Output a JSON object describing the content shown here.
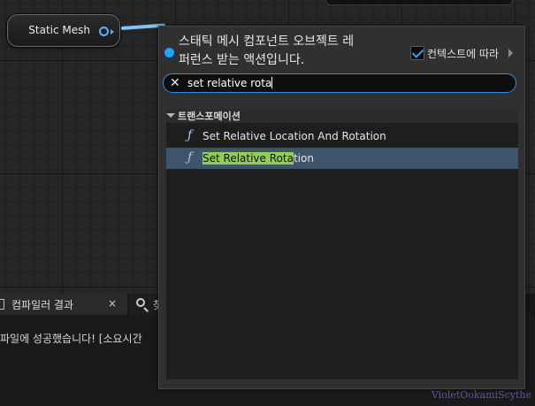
{
  "node": {
    "label": "Static Mesh"
  },
  "popup": {
    "title": "스태틱 메시 컴포넌트 오브젝트 레퍼런스 받는 액션입니다.",
    "context_label": "컨텍스트에 따라",
    "context_checked": true,
    "search": {
      "value": "set relative rota"
    },
    "category": "트랜스포메이션",
    "actions": [
      {
        "label": "Set Relative Location And Rotation",
        "selected": false
      },
      {
        "label_match": "Set Relative Rota",
        "label_rest": "tion",
        "selected": true
      }
    ]
  },
  "bottom": {
    "tabs": [
      {
        "label": "컴파일러 결과",
        "close": "×"
      },
      {
        "label": "찾"
      }
    ],
    "log_line": "파일에 성공했습니다! [소요시간"
  },
  "watermark": "VioletOokamiScythe",
  "colors": {
    "accent": "#2f8de4",
    "selection": "#3e546b",
    "match_highlight": "#8fd14f",
    "pin": "#17a7ff"
  }
}
